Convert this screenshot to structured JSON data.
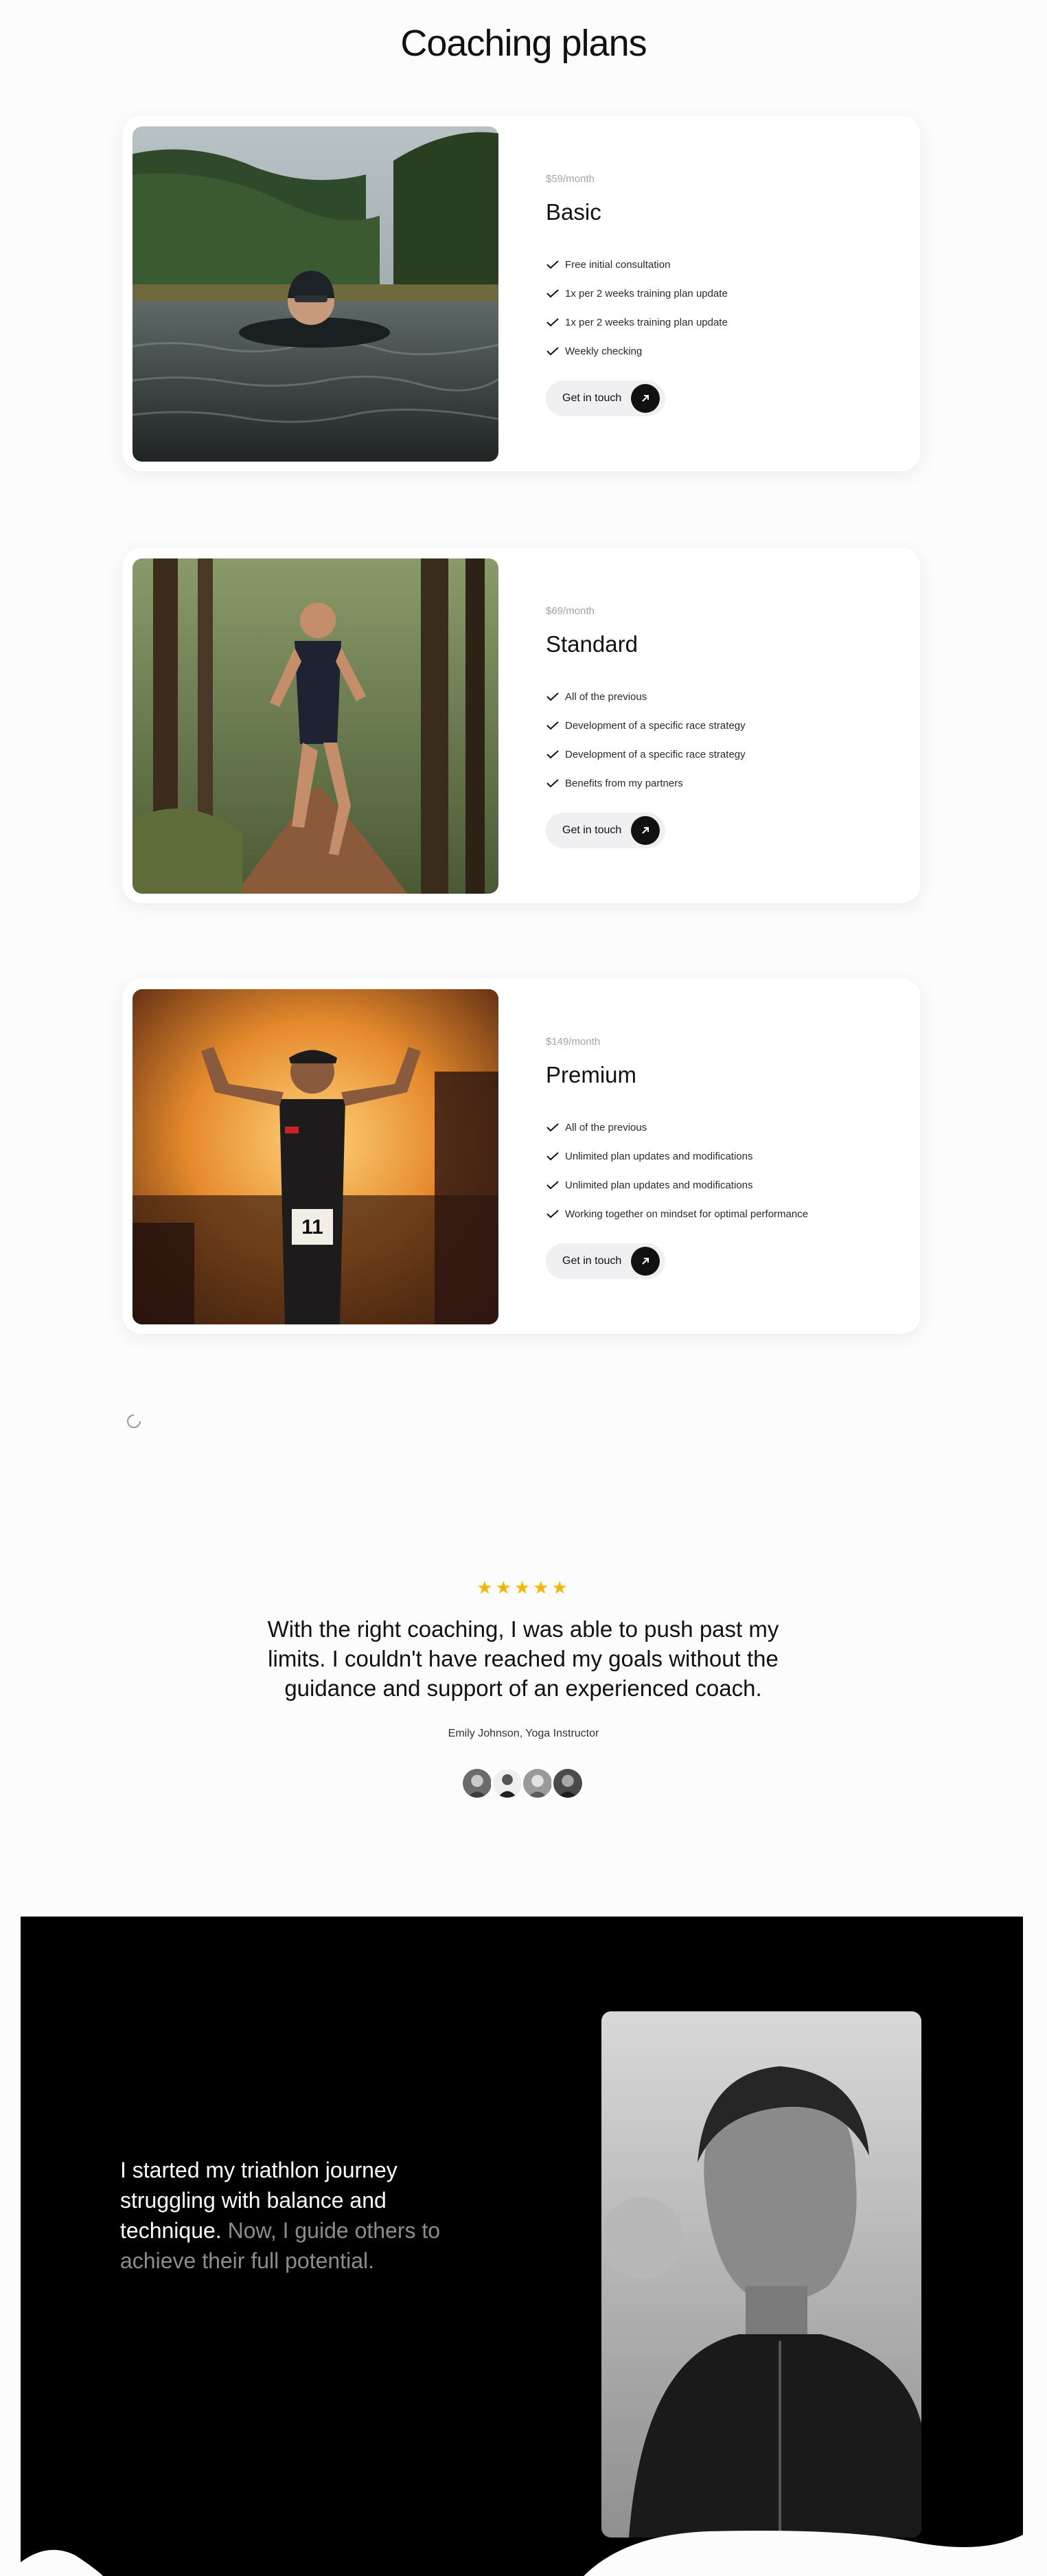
{
  "page": {
    "title": "Coaching plans"
  },
  "plans": [
    {
      "price": "$59/month",
      "name": "Basic",
      "features": [
        "Free initial consultation",
        "1x per 2 weeks training plan update",
        "1x per 2 weeks training plan update",
        "Weekly checking"
      ],
      "cta": "Get in touch"
    },
    {
      "price": "$69/month",
      "name": "Standard",
      "features": [
        "All of the previous",
        "Development of a specific race strategy",
        "Development of a specific race strategy",
        "Benefits from my partners"
      ],
      "cta": "Get in touch"
    },
    {
      "price": "$149/month",
      "name": "Premium",
      "features": [
        "All of the previous",
        "Unlimited plan updates and modifications",
        "Unlimited plan updates and modifications",
        "Working together on mindset for optimal performance"
      ],
      "cta": "Get in touch"
    }
  ],
  "testimonial": {
    "rating": "★★★★★",
    "quote": "With the right coaching, I was able to push past my limits. I couldn't have reached my goals without the guidance and support of an experienced coach.",
    "author": "Emily Johnson, Yoga Instructor"
  },
  "story": {
    "strong": "I started my triathlon journey struggling with balance and technique.",
    "soft": " Now, I guide others to achieve their full potential."
  },
  "colors": {
    "accent_dark": "#111111",
    "star": "#f2b705",
    "story_bg": "#000000",
    "muted_text": "#8c8c8c"
  },
  "icons": {
    "check": "check-icon",
    "arrow": "arrow-up-right-icon",
    "loader": "loader-icon"
  }
}
